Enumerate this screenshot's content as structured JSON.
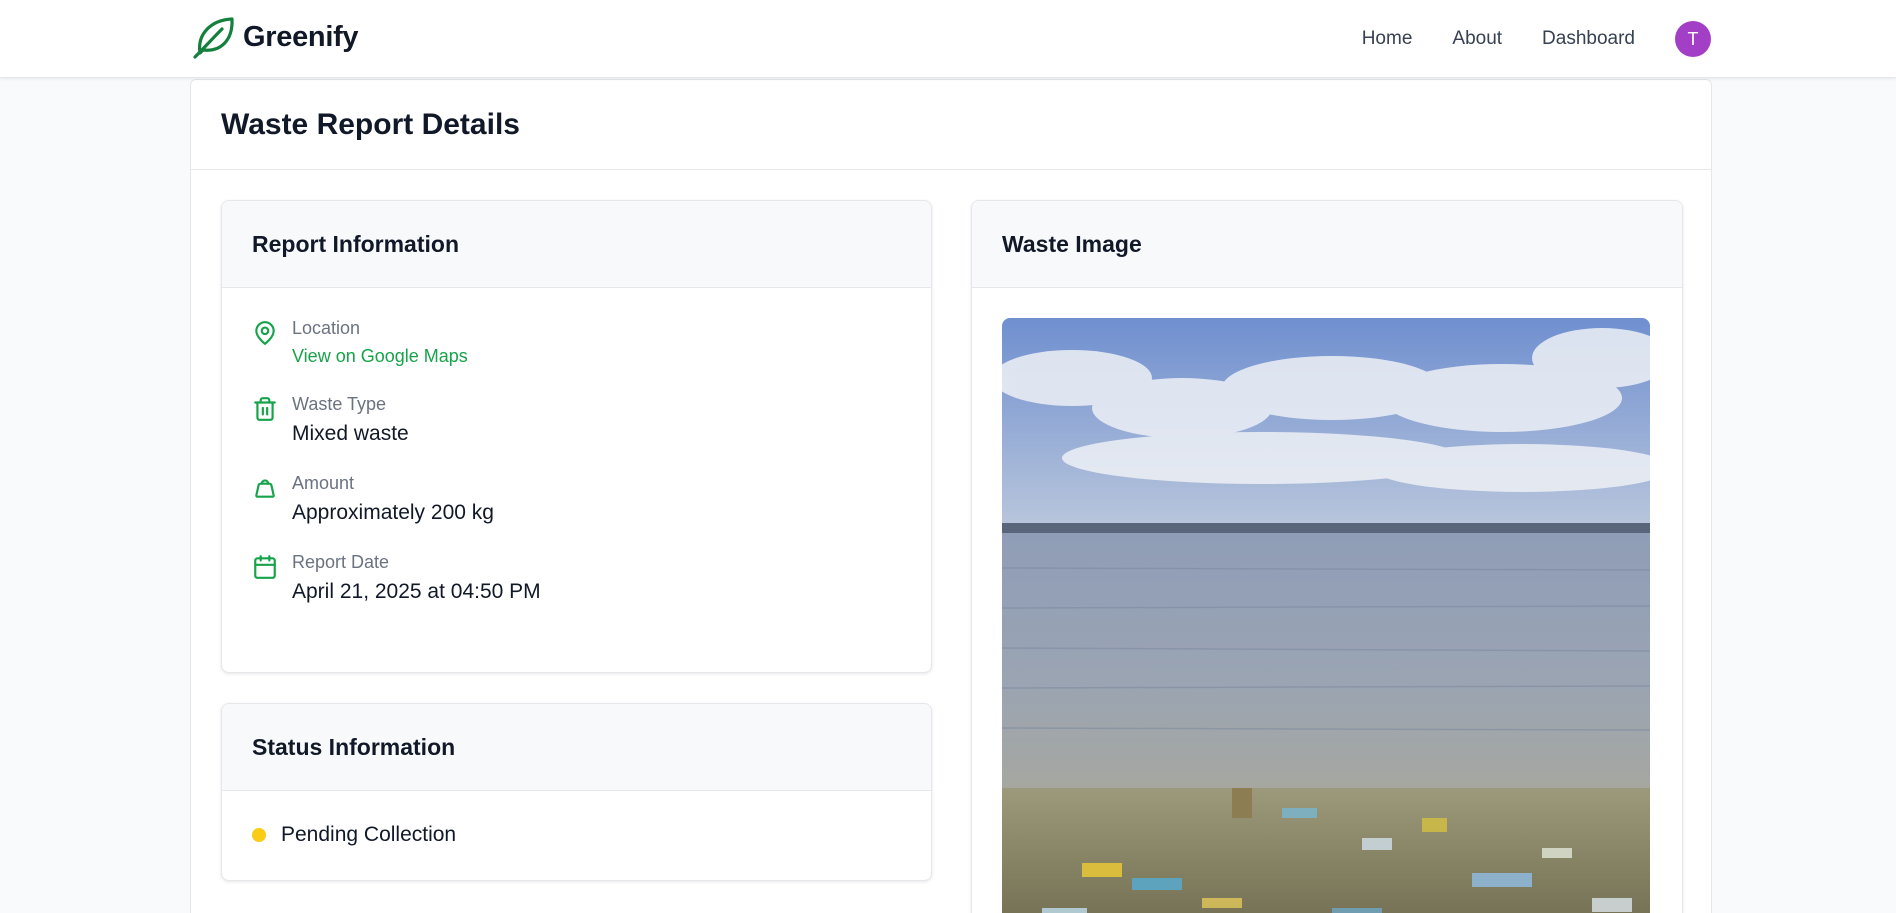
{
  "navbar": {
    "brand": "Greenify",
    "logo_icon": "leaf-icon",
    "links": [
      "Home",
      "About",
      "Dashboard"
    ],
    "avatar_initial": "T",
    "avatar_color": "#a33ec7"
  },
  "page": {
    "title": "Waste Report Details"
  },
  "report_info": {
    "title": "Report Information",
    "location": {
      "label": "Location",
      "link_text": "View on Google Maps",
      "icon": "map-pin-icon"
    },
    "waste_type": {
      "label": "Waste Type",
      "value": "Mixed waste",
      "icon": "trash-icon"
    },
    "amount": {
      "label": "Amount",
      "value": "Approximately 200 kg",
      "icon": "bag-icon"
    },
    "report_date": {
      "label": "Report Date",
      "value": "April 21, 2025 at 04:50 PM",
      "icon": "calendar-icon"
    }
  },
  "status_info": {
    "title": "Status Information",
    "status": "Pending Collection",
    "status_color": "#facc15"
  },
  "waste_image": {
    "title": "Waste Image"
  },
  "colors": {
    "accent": "#16a34a"
  }
}
